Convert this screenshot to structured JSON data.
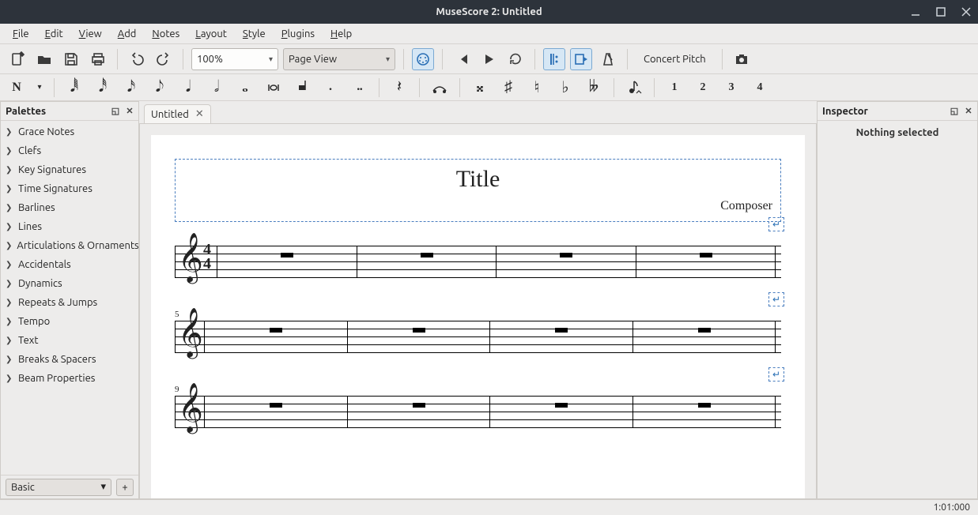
{
  "window": {
    "title": "MuseScore 2: Untitled"
  },
  "menubar": [
    "File",
    "Edit",
    "View",
    "Add",
    "Notes",
    "Layout",
    "Style",
    "Plugins",
    "Help"
  ],
  "toolbar": {
    "zoom": "100%",
    "view_mode": "Page View",
    "concert_pitch": "Concert Pitch"
  },
  "notesbar": {
    "voices": [
      "1",
      "2",
      "3",
      "4"
    ]
  },
  "palettes": {
    "title": "Palettes",
    "items": [
      "Grace Notes",
      "Clefs",
      "Key Signatures",
      "Time Signatures",
      "Barlines",
      "Lines",
      "Articulations & Ornaments",
      "Accidentals",
      "Dynamics",
      "Repeats & Jumps",
      "Tempo",
      "Text",
      "Breaks & Spacers",
      "Beam Properties"
    ],
    "workspace": "Basic"
  },
  "tabs": [
    {
      "label": "Untitled"
    }
  ],
  "score": {
    "title": "Title",
    "composer": "Composer",
    "timesig_top": "4",
    "timesig_bottom": "4",
    "systems": [
      {
        "num": "",
        "first": true
      },
      {
        "num": "5",
        "first": false
      },
      {
        "num": "9",
        "first": false
      }
    ]
  },
  "inspector": {
    "title": "Inspector",
    "empty": "Nothing selected"
  },
  "status": {
    "position": "1:01:000"
  }
}
